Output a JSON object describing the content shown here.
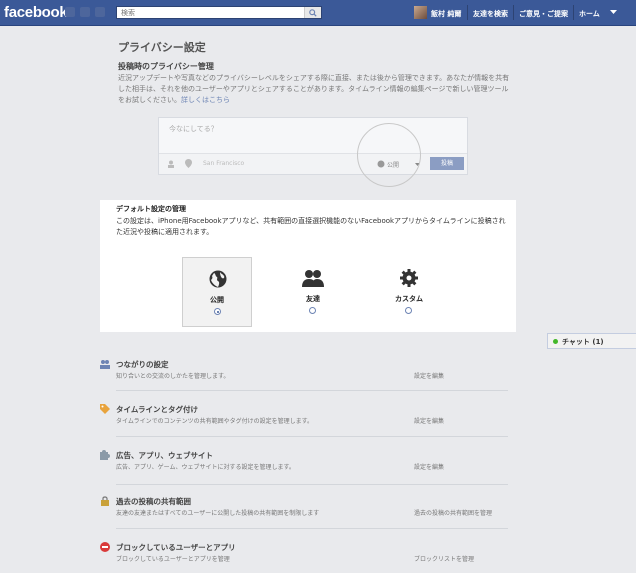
{
  "topbar": {
    "logo": "facebook",
    "search_placeholder": "検索",
    "user_name": "飯村 純爾",
    "nav": [
      "友達を検索",
      "ご意見・ご提案",
      "ホーム"
    ]
  },
  "page": {
    "title": "プライバシー設定",
    "section_title": "投稿時のプライバシー管理",
    "section_desc": "近況アップデートや写真などのプライバシーレベルをシェアする際に直接、または後から管理できます。あなたが情報を共有した相手は、それを他のユーザーやアプリとシェアすることがあります。タイムライン情報の編集ページで新しい管理ツールをお試しください。",
    "section_link": "詳しくはこちら"
  },
  "composer": {
    "placeholder": "今なにしてる？",
    "location": "San Francisco",
    "audience": "公開",
    "post_button": "投稿"
  },
  "default_settings": {
    "title": "デフォルト設定の管理",
    "desc": "この設定は、iPhone用Facebookアプリなど、共有範囲の直接選択機能のないFacebookアプリからタイムラインに投稿された近況や投稿に適用されます。",
    "options": [
      {
        "label": "公開",
        "icon": "globe-icon",
        "selected": true
      },
      {
        "label": "友達",
        "icon": "friends-icon",
        "selected": false
      },
      {
        "label": "カスタム",
        "icon": "gear-icon",
        "selected": false
      }
    ]
  },
  "chat": {
    "label": "チャット (1)"
  },
  "settings": [
    {
      "title": "つながりの設定",
      "desc": "知り合いとの交流のしかたを管理します。",
      "edit": "設定を編集",
      "icon": "people-icon"
    },
    {
      "title": "タイムラインとタグ付け",
      "desc": "タイムラインでのコンテンツの共有範囲やタグ付けの設定を管理します。",
      "edit": "設定を編集",
      "icon": "tag-icon"
    },
    {
      "title": "広告、アプリ、ウェブサイト",
      "desc": "広告、アプリ、ゲーム、ウェブサイトに対する設定を管理します。",
      "edit": "設定を編集",
      "icon": "puzzle-icon"
    },
    {
      "title": "過去の投稿の共有範囲",
      "desc": "友達の友達またはすべてのユーザーに公開した投稿の共有範囲を制限します",
      "edit": "過去の投稿の共有範囲を管理",
      "icon": "lock-icon"
    },
    {
      "title": "ブロックしているユーザーとアプリ",
      "desc": "ブロックしているユーザーとアプリを管理",
      "edit": "ブロックリストを管理",
      "icon": "block-icon"
    }
  ],
  "colors": {
    "brand": "#3b5998",
    "page_bg": "#e9eaed"
  }
}
